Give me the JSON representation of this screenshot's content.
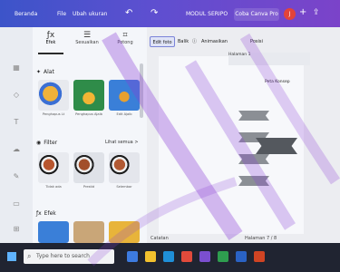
{
  "appbar": {
    "home": "Beranda",
    "file": "File",
    "save_status": "Ubah ukuran",
    "doc_title": "MODUL SERIPO",
    "pro_label": "Coba Canva Pro",
    "avatar_letter": "J"
  },
  "panel": {
    "tabs": [
      {
        "label": "Efek"
      },
      {
        "label": "Sesuaikan"
      },
      {
        "label": "Potong"
      }
    ],
    "alat_title": "Alat",
    "alat_items": [
      {
        "label": "Penghapus Lt"
      },
      {
        "label": "Penghapus Ajaib"
      },
      {
        "label": "Edit Ajaib"
      }
    ],
    "filter_title": "Filter",
    "filter_see_all": "Lihat semua >",
    "filter_items": [
      {
        "label": "Tidak ada"
      },
      {
        "label": "Prestid"
      },
      {
        "label": "Selembar"
      }
    ],
    "efek_title": "Efek"
  },
  "canvas": {
    "tools": [
      {
        "label": "Edit foto"
      },
      {
        "label": "Balik"
      },
      {
        "label": "Animasikan"
      },
      {
        "label": "Posisi"
      }
    ],
    "page_label": "Halaman 1",
    "element_label": "Peta Konsep",
    "notes_label": "Catatan",
    "footer_page": "Halaman 7 / 8"
  },
  "taskbar": {
    "search_placeholder": "Type here to search"
  }
}
